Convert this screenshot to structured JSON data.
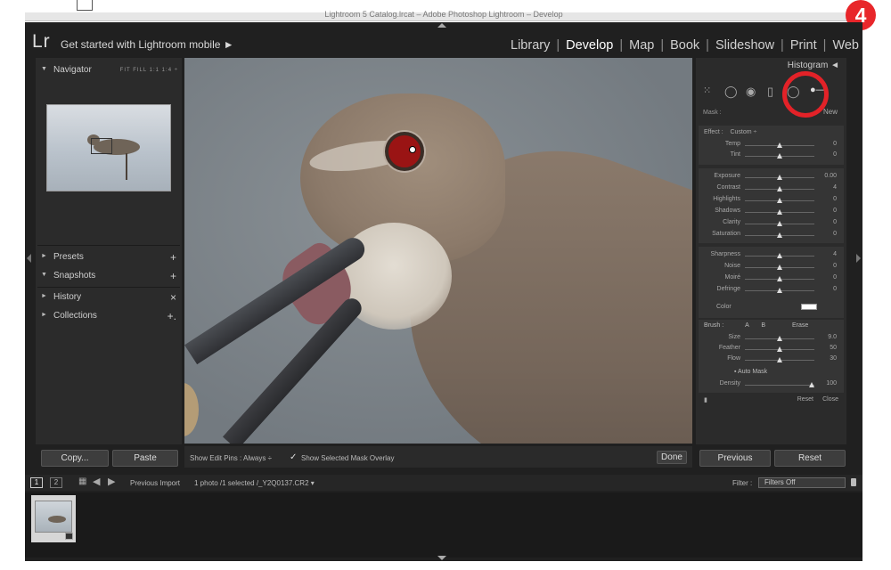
{
  "window": {
    "title": "Lightroom 5 Catalog.lrcat – Adobe Photoshop Lightroom – Develop"
  },
  "step_badge": "4",
  "identity": {
    "logo": "Lr",
    "mobile_prompt": "Get started with Lightroom mobile ►"
  },
  "modules": [
    "Library",
    "Develop",
    "Map",
    "Book",
    "Slideshow",
    "Print",
    "Web"
  ],
  "active_module": "Develop",
  "left_panel": {
    "navigator": {
      "title": "Navigator",
      "zoom_options": "FIT  FILL  1:1  1:4 ÷"
    },
    "presets": "Presets",
    "snapshots": "Snapshots",
    "history": "History",
    "collections": "Collections",
    "copy_label": "Copy...",
    "paste_label": "Paste"
  },
  "toolbar": {
    "show_edit_pins_label": "Show Edit Pins :",
    "show_edit_pins_value": "Always ÷",
    "mask_overlay_label": "Show Selected Mask Overlay",
    "done_label": "Done"
  },
  "right_panel": {
    "histogram_label": "Histogram ◄",
    "mask_label": "Mask :",
    "mask_new": "New",
    "effect_label": "Effect :",
    "effect_value": "Custom ÷",
    "sliders_group1": [
      {
        "label": "Temp",
        "value": "0"
      },
      {
        "label": "Tint",
        "value": "0"
      }
    ],
    "sliders_group2": [
      {
        "label": "Exposure",
        "value": "0.00"
      },
      {
        "label": "Contrast",
        "value": "4"
      },
      {
        "label": "Highlights",
        "value": "0"
      },
      {
        "label": "Shadows",
        "value": "0"
      },
      {
        "label": "Clarity",
        "value": "0"
      },
      {
        "label": "Saturation",
        "value": "0"
      }
    ],
    "sliders_group3": [
      {
        "label": "Sharpness",
        "value": "4"
      },
      {
        "label": "Noise",
        "value": "0"
      },
      {
        "label": "Moiré",
        "value": "0"
      },
      {
        "label": "Defringe",
        "value": "0"
      }
    ],
    "color_label": "Color",
    "brush": {
      "label": "Brush :",
      "a": "A",
      "b": "B",
      "erase": "Erase",
      "sliders": [
        {
          "label": "Size",
          "value": "9.0"
        },
        {
          "label": "Feather",
          "value": "50"
        },
        {
          "label": "Flow",
          "value": "30"
        }
      ],
      "auto_mask": "Auto Mask",
      "density_label": "Density",
      "density_value": "100"
    },
    "reset_small": "Reset",
    "close_small": "Close",
    "previous_label": "Previous",
    "reset_label": "Reset"
  },
  "filmstrip": {
    "screen1": "1",
    "screen2": "2",
    "source": "Previous Import",
    "info": "1 photo /1 selected /_Y2Q0137.CR2 ▾",
    "filter_label": "Filter :",
    "filter_value": "Filters Off"
  }
}
